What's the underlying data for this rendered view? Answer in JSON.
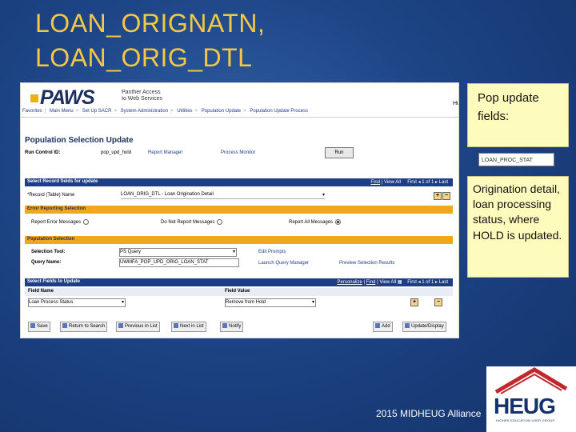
{
  "slide": {
    "title_line1": "LOAN_ORIGNATN,",
    "title_line2": "LOAN_ORIG_DTL",
    "footer": "2015 MIDHEUG Alliance",
    "logo_text": "HEUG",
    "logo_subtext": "HIGHER EDUCATION USER GROUP",
    "colors": {
      "title": "#f4c842",
      "background": "#1d4485",
      "callout": "#fefcbc"
    }
  },
  "callouts": {
    "pop_update": "Pop update fields:",
    "field_tag": "LOAN_PROC_STAT",
    "description": "Origination detail, loan processing status, where HOLD is updated."
  },
  "app": {
    "logo": "PAWS",
    "tagline": [
      "Panther Access",
      "to Web Services"
    ],
    "header_right": "Hu",
    "nav": [
      "Favorites",
      "Main Menu",
      "Set Up SACR",
      "System Administration",
      "Utilities",
      "Population Update",
      "Population Update Process"
    ],
    "page_title": "Population Selection Update",
    "run_control": {
      "label": "Run Control ID:",
      "value": "pop_upd_hold",
      "report_manager": "Report Manager",
      "process_monitor": "Process Monitor",
      "run_button": "Run"
    },
    "record_grid": {
      "header": "Select Record fields for update",
      "find": "Find",
      "view_all": "View All",
      "first": "First",
      "page_info": "1 of 1",
      "last": "Last",
      "record_label": "*Record (Table) Name",
      "record_value": "LOAN_ORIG_DTL - Loan Origination Detail"
    },
    "error_reporting": {
      "header": "Error Reporting Selection",
      "option1": "Report Error Messages",
      "option2": "Do Not Report Messages",
      "option3": "Report All Messages"
    },
    "population": {
      "header": "Population Selection",
      "tool_label": "Selection Tool:",
      "tool_value": "PS Query",
      "edit_prompts": "Edit Prompts",
      "query_label": "Query Name:",
      "query_value": "UWMFA_POP_UPD_ORIG_LOAN_STAT",
      "launch_query": "Launch Query Manager",
      "preview": "Preview Selection Results"
    },
    "fields_grid": {
      "header": "Select Fields to Update",
      "personalize": "Personalize",
      "find": "Find",
      "view_all": "View All",
      "first": "First",
      "page_info": "1 of 1",
      "last": "Last",
      "col_field_name": "Field Name",
      "col_field_value": "Field Value",
      "row_field": "Loan Process Status",
      "row_value": "Remove from Hold"
    },
    "toolbar": {
      "save": "Save",
      "return": "Return to Search",
      "previous": "Previous in List",
      "next": "Next in List",
      "notify": "Notify",
      "add": "Add",
      "update": "Update/Display"
    }
  }
}
